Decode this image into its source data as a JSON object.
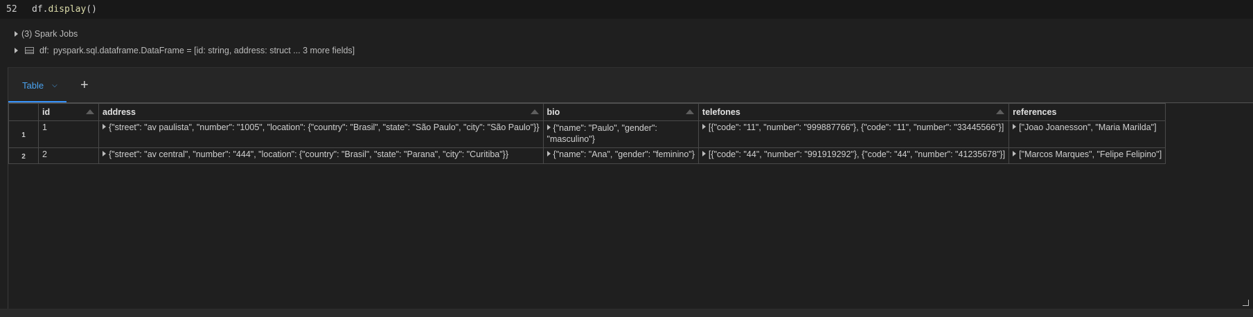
{
  "cell": {
    "line_number": "52",
    "code_var": "df",
    "code_dot": ".",
    "code_fn": "display",
    "code_parens": "()"
  },
  "output": {
    "spark_jobs": "(3) Spark Jobs",
    "df_label": "df:",
    "df_schema": "pyspark.sql.dataframe.DataFrame = [id: string, address: struct ... 3 more fields]"
  },
  "tabs": {
    "active": "Table",
    "chevron": "⌄",
    "add": "+"
  },
  "table": {
    "columns": [
      "id",
      "address",
      "bio",
      "telefones",
      "references"
    ],
    "rows": [
      {
        "num": "1",
        "id": "1",
        "address": "{\"street\": \"av paulista\", \"number\": \"1005\", \"location\": {\"country\": \"Brasil\", \"state\": \"São Paulo\", \"city\": \"São Paulo\"}}",
        "bio": "{\"name\": \"Paulo\", \"gender\": \"masculino\"}",
        "telefones": "[{\"code\": \"11\", \"number\": \"999887766\"}, {\"code\": \"11\", \"number\": \"33445566\"}]",
        "references": "[\"Joao Joanesson\", \"Maria Marilda\"]"
      },
      {
        "num": "2",
        "id": "2",
        "address": "{\"street\": \"av central\", \"number\": \"444\", \"location\": {\"country\": \"Brasil\", \"state\": \"Parana\", \"city\": \"Curitiba\"}}",
        "bio": "{\"name\": \"Ana\", \"gender\": \"feminino\"}",
        "telefones": "[{\"code\": \"44\", \"number\": \"991919292\"}, {\"code\": \"44\", \"number\": \"41235678\"}]",
        "references": "[\"Marcos Marques\", \"Felipe Felipino\"]"
      }
    ]
  },
  "colors": {
    "accent": "#3794ff",
    "background": "#1f1f1f"
  }
}
